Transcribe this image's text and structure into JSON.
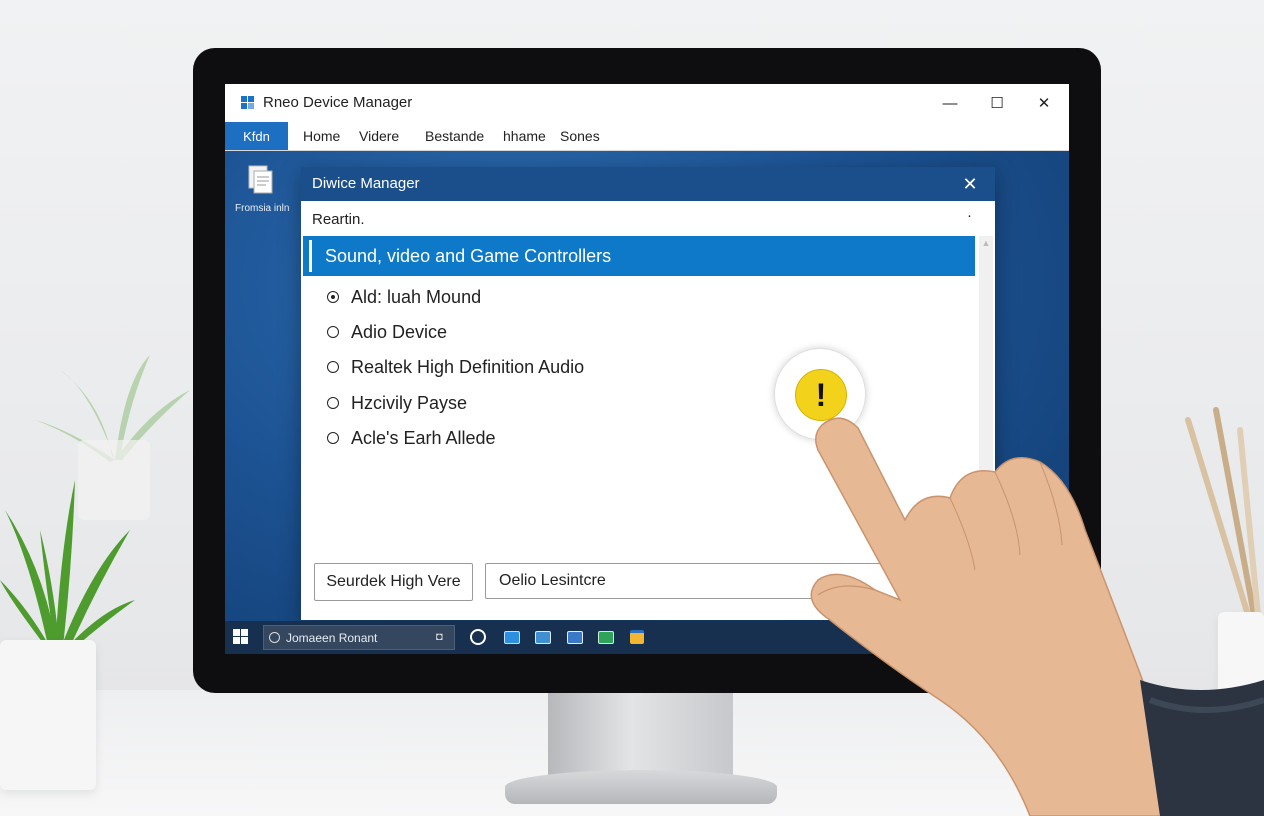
{
  "window": {
    "title": "Rneo Device Manager",
    "minimize_glyph": "—",
    "maximize_glyph": "☐",
    "close_glyph": "✕"
  },
  "menu": {
    "active": "Kfdn",
    "items": [
      "Home",
      "Videre",
      "Bestande",
      "hhame",
      "Sones"
    ]
  },
  "desktop_icon": {
    "label": "Fromsia inln",
    "icon": "document-icon"
  },
  "dialog": {
    "title": "Diwice Manager",
    "close_glyph": "✕",
    "search_text": "Reartin.",
    "dot": "·",
    "category": "Sound, video and Game Controllers",
    "devices": [
      {
        "label": "Ald: luah Mound",
        "selected": true
      },
      {
        "label": "Adio Device",
        "selected": false
      },
      {
        "label": "Realtek High Definition Audio",
        "selected": false
      },
      {
        "label": "Hzcivily Payse",
        "selected": false
      },
      {
        "label": "Acle's Earh Allede",
        "selected": false
      }
    ],
    "button_label": "Seurdek High Vere",
    "field_value": "Oelio Lesintcre",
    "warning_glyph": "!"
  },
  "taskbar": {
    "search_text": "Jomaeen Ronant",
    "mic_glyph": "◘",
    "apps": [
      "edge-icon",
      "mail-icon",
      "photos-icon",
      "store-icon",
      "excel-icon",
      "explorer-icon"
    ]
  },
  "colors": {
    "accent": "#0f79c9",
    "dialog_title": "#1b4f8c",
    "warning": "#f3d21b"
  }
}
